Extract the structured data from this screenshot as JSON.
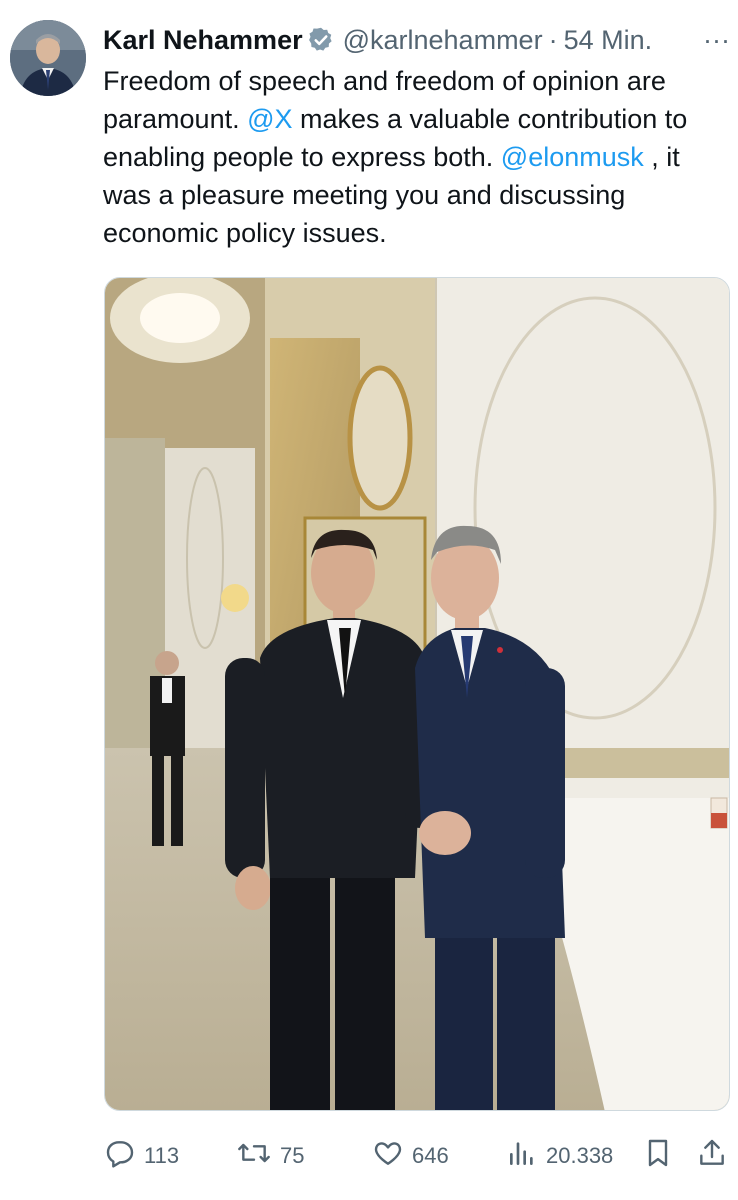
{
  "author": {
    "name": "Karl Nehammer",
    "handle": "@karlnehammer",
    "time": "54 Min.",
    "separator": "·",
    "more": "···"
  },
  "tweet": {
    "part1": "Freedom of speech and freedom of opinion are paramount. ",
    "mention_x": "@X",
    "part2": " makes a valuable contribution to enabling people to express both. ",
    "mention_elon": "@elonmusk",
    "part3": " , it was a pleasure meeting you and discussing economic policy issues."
  },
  "actions": {
    "replies": "113",
    "reposts": "75",
    "likes": "646",
    "views": "20.338"
  },
  "colors": {
    "link": "#1d9bf0",
    "muted": "#536471",
    "text": "#0f1419"
  },
  "icons": [
    "verified-badge-icon",
    "reply-icon",
    "repost-icon",
    "like-icon",
    "views-icon",
    "bookmark-icon",
    "share-icon",
    "more-icon"
  ]
}
